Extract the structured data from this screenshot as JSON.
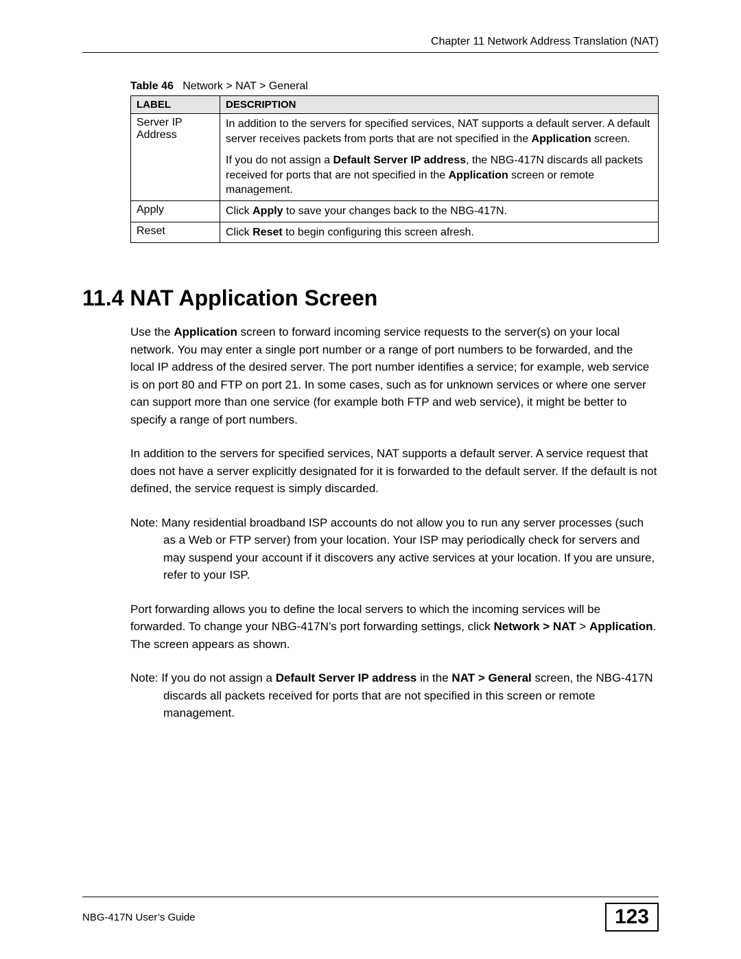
{
  "header": {
    "chapter_line": "Chapter 11 Network Address Translation (NAT)"
  },
  "table": {
    "caption_label": "Table 46",
    "caption_text": "Network > NAT > General",
    "head": {
      "col1": "LABEL",
      "col2": "DESCRIPTION"
    },
    "rows": {
      "r0": {
        "label_line1": "Server IP",
        "label_line2": "Address"
      },
      "r1": {
        "label": "Apply"
      },
      "r2": {
        "label": "Reset"
      }
    }
  },
  "section": {
    "heading": "11.4  NAT Application Screen"
  },
  "footer": {
    "guide": "NBG-417N User’s Guide",
    "page": "123"
  }
}
